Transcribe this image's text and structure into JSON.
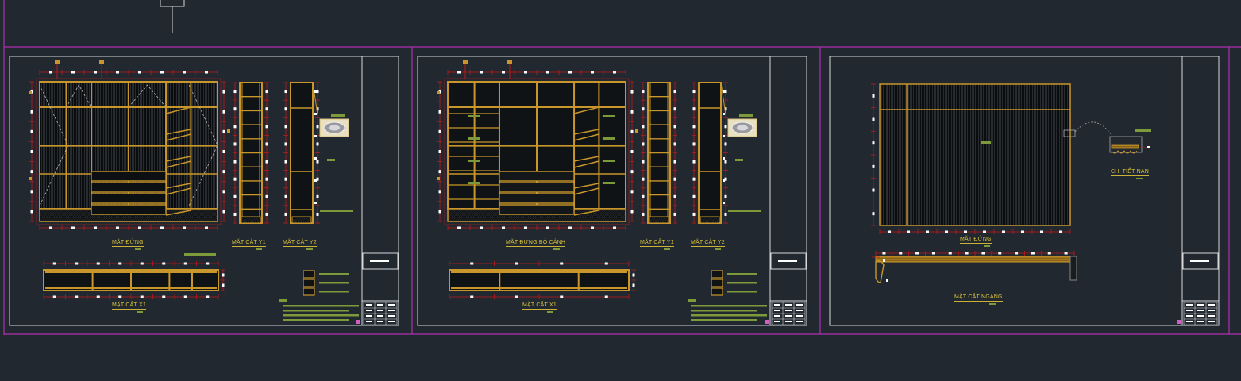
{
  "sheets": [
    {
      "views": {
        "elevation": "MẶT ĐỨNG",
        "section_y1": "MẶT CẮT Y1",
        "section_y2": "MẶT CẮT Y2",
        "section_x1": "MẶT CẮT X1"
      }
    },
    {
      "views": {
        "elevation": "MẶT ĐỨNG BỎ CÁNH",
        "section_y1": "MẶT CẮT Y1",
        "section_y2": "MẶT CẮT Y2",
        "section_x1": "MẶT CẮT X1"
      }
    },
    {
      "views": {
        "elevation": "MẶT ĐỨNG",
        "detail": "CHI TIẾT NAN",
        "section_h": "MẶT CẮT NGANG"
      }
    }
  ],
  "colors": {
    "background": "#212830",
    "sheet_border": "#b030b0",
    "frame": "#d8d8d8",
    "wood": "#c8962a",
    "dimension": "#c01818",
    "dim_text": "#ffffff",
    "label": "#d9c23a",
    "note_bar": "#7d9a3a"
  }
}
